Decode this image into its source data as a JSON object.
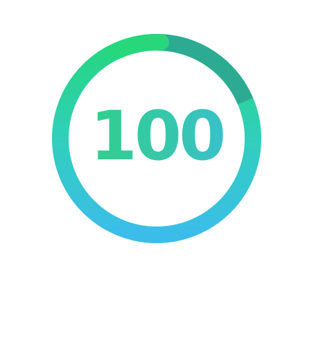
{
  "score_gauge": {
    "value": "100",
    "progress_fraction": 1.0
  },
  "colors": {
    "gradient_top": "#22d87c",
    "gradient_right": "#2fb49c",
    "gradient_bottom": "#3bbdea",
    "track": "#2aaa93"
  }
}
